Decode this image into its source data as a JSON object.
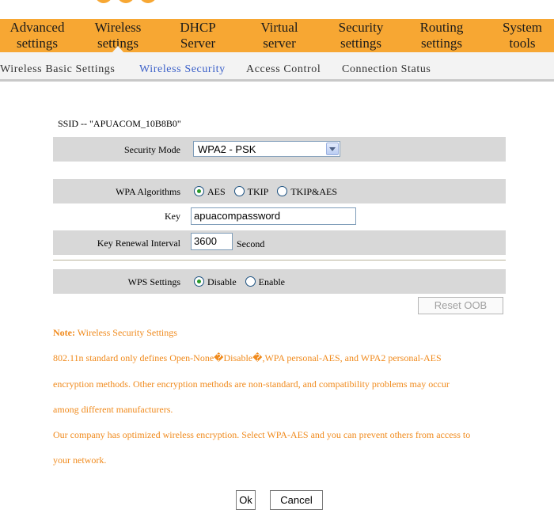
{
  "main_nav": [
    {
      "line1": "Advanced",
      "line2": "settings"
    },
    {
      "line1": "Wireless",
      "line2": "settings"
    },
    {
      "line1": "DHCP",
      "line2": "Server"
    },
    {
      "line1": "Virtual",
      "line2": "server"
    },
    {
      "line1": "Security",
      "line2": "settings"
    },
    {
      "line1": "Routing",
      "line2": "settings"
    },
    {
      "line1": "System",
      "line2": "tools"
    }
  ],
  "sub_nav": [
    {
      "label": "Wireless Basic Settings"
    },
    {
      "label": "Wireless Security"
    },
    {
      "label": "Access Control"
    },
    {
      "label": "Connection Status"
    }
  ],
  "ssid_text": "SSID -- \"APUACOM_10B8B0\"",
  "form": {
    "security_mode": {
      "label": "Security Mode",
      "value": "WPA2 - PSK"
    },
    "wpa_algorithms": {
      "label": "WPA Algorithms",
      "options": [
        "AES",
        "TKIP",
        "TKIP&AES"
      ],
      "selected": "AES"
    },
    "key": {
      "label": "Key",
      "value": "apuacompassword"
    },
    "key_renewal": {
      "label": "Key Renewal Interval",
      "value": "3600",
      "unit": "Second"
    },
    "wps": {
      "label": "WPS Settings",
      "options": [
        "Disable",
        "Enable"
      ],
      "selected": "Disable"
    },
    "reset_oob_label": "Reset OOB"
  },
  "note": {
    "heading": "Note:",
    "title": " Wireless Security Settings",
    "lines": [
      "802.11n standard only defines Open-None�Disable�,WPA personal-AES, and WPA2 personal-AES",
      "encryption methods. Other encryption methods are non-standard, and compatibility problems may occur",
      "among different manufacturers.",
      "Our company has optimized wireless encryption. Select WPA-AES and you can prevent others from access to",
      "your network."
    ]
  },
  "buttons": {
    "ok": "Ok",
    "cancel": "Cancel"
  },
  "colors": {
    "nav_orange": "#f7a733",
    "note_orange": "#f08a1c",
    "active_tab": "#3a5fc8",
    "row_gray": "#d8d8d8"
  }
}
